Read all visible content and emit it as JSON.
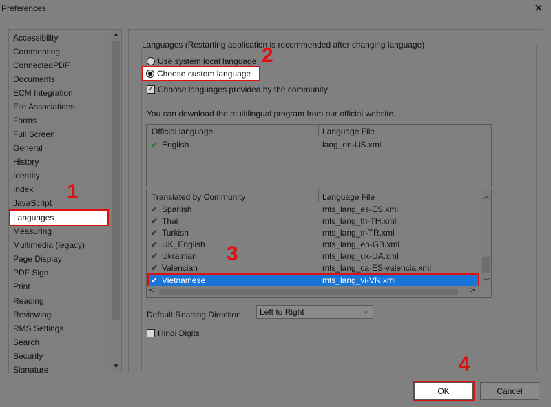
{
  "window": {
    "title": "Preferences",
    "close_glyph": "✕"
  },
  "sidebar": {
    "items": [
      {
        "label": "Accessibility"
      },
      {
        "label": "Commenting"
      },
      {
        "label": "ConnectedPDF"
      },
      {
        "label": "Documents"
      },
      {
        "label": "ECM Integration"
      },
      {
        "label": "File Associations"
      },
      {
        "label": "Forms"
      },
      {
        "label": "Full Screen"
      },
      {
        "label": "General"
      },
      {
        "label": "History"
      },
      {
        "label": "Identity"
      },
      {
        "label": "Index"
      },
      {
        "label": "JavaScript"
      },
      {
        "label": "Languages",
        "selected": true
      },
      {
        "label": "Measuring"
      },
      {
        "label": "Multimedia (legacy)"
      },
      {
        "label": "Page Display"
      },
      {
        "label": "PDF Sign"
      },
      {
        "label": "Print"
      },
      {
        "label": "Reading"
      },
      {
        "label": "Reviewing"
      },
      {
        "label": "RMS Settings"
      },
      {
        "label": "Search"
      },
      {
        "label": "Security"
      },
      {
        "label": "Signature"
      }
    ],
    "scroll_up": "▲",
    "scroll_down": "▼"
  },
  "languages": {
    "group_label": "Languages (Restarting application is recommended after changing language)",
    "radio_system": "Use system local language",
    "radio_custom": "Choose custom language",
    "checkbox_community": "Choose languages provided by the community",
    "info": "You can download the multilingual program from our official website.",
    "official_table": {
      "headers": [
        "Official language",
        "Language File"
      ],
      "rows": [
        {
          "language": "English",
          "file": "lang_en-US.xml"
        }
      ]
    },
    "community_table": {
      "headers": [
        "Translated by Community",
        "Language File"
      ],
      "rows": [
        {
          "language": "Spanish",
          "file": "mts_lang_es-ES.xml"
        },
        {
          "language": "Thai",
          "file": "mts_lang_th-TH.xml"
        },
        {
          "language": "Turkish",
          "file": "mts_lang_tr-TR.xml"
        },
        {
          "language": "UK_English",
          "file": "mts_lang_en-GB.xml"
        },
        {
          "language": "Ukrainian",
          "file": "mts_lang_uk-UA.xml"
        },
        {
          "language": "Valencian",
          "file": "mts_lang_ca-ES-valencia.xml"
        },
        {
          "language": "Vietnamese",
          "file": "mts_lang_vi-VN.xml",
          "selected": true
        }
      ]
    },
    "reading_direction_label": "Default Reading Direction:",
    "reading_direction_value": "Left to Right",
    "hindi_digits": "Hindi Digits"
  },
  "buttons": {
    "ok": "OK",
    "cancel": "Cancel"
  },
  "markers": [
    "1",
    "2",
    "3",
    "4"
  ],
  "glyphs": {
    "check": "✔",
    "box_check": "✓",
    "dd_arrow": "⌵",
    "left": "<",
    "right": ">",
    "up": "︿",
    "down": "﹀"
  },
  "colors": {
    "highlight": "#e01010",
    "selection": "#1874d6"
  }
}
